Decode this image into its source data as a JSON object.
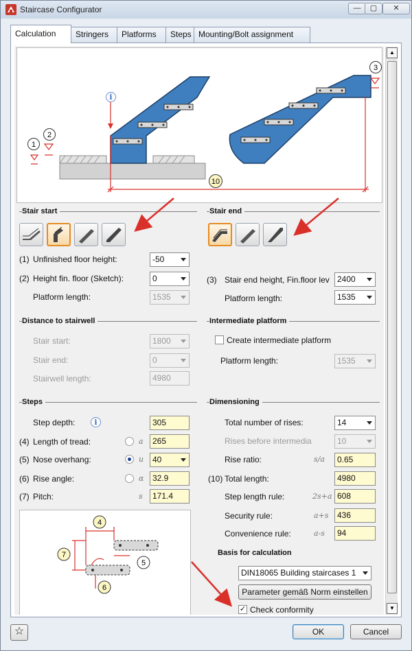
{
  "window": {
    "title": "Staircase Configurator",
    "minimize": "—",
    "maximize": "▢",
    "close": "✕"
  },
  "tabs": [
    "Calculation",
    "Stringers",
    "Platforms",
    "Steps",
    "Mounting/Bolt assignment"
  ],
  "diagram": {
    "markers": [
      "1",
      "2",
      "3",
      "10"
    ],
    "info": "i"
  },
  "stair_start": {
    "title": "Stair start",
    "unfinished_floor": {
      "num": "(1)",
      "label": "Unfinished floor height:",
      "value": "-50"
    },
    "height_fin_floor": {
      "num": "(2)",
      "label": "Height fin. floor  (Sketch):",
      "value": "0"
    },
    "platform_length": {
      "label": "Platform length:",
      "value": "1535"
    }
  },
  "stair_end": {
    "title": "Stair end",
    "end_height": {
      "num": "(3)",
      "label": "Stair end height, Fin.floor lev",
      "value": "2400"
    },
    "platform_length": {
      "label": "Platform length:",
      "value": "1535"
    }
  },
  "stairwell": {
    "title": "Distance to stairwell",
    "start": {
      "label": "Stair start:",
      "value": "1800"
    },
    "end": {
      "label": "Stair end:",
      "value": "0"
    },
    "length": {
      "label": "Stairwell length:",
      "value": "4980"
    }
  },
  "intermediate": {
    "title": "Intermediate platform",
    "create_label": "Create intermediate platform",
    "platform_length": {
      "label": "Platform length:",
      "value": "1535"
    }
  },
  "steps": {
    "title": "Steps",
    "step_depth": {
      "label": "Step depth:",
      "value": "305"
    },
    "tread": {
      "num": "(4)",
      "label": "Length of tread:",
      "sym": "a",
      "value": "265"
    },
    "nose": {
      "num": "(5)",
      "label": "Nose overhang:",
      "sym": "u",
      "value": "40"
    },
    "rise_angle": {
      "num": "(6)",
      "label": "Rise angle:",
      "sym": "α",
      "value": "32.9"
    },
    "pitch": {
      "num": "(7)",
      "label": "Pitch:",
      "sym": "s",
      "value": "171.4"
    },
    "sketch_markers": [
      "4",
      "5",
      "6",
      "7"
    ]
  },
  "dimensioning": {
    "title": "Dimensioning",
    "total_rises": {
      "label": "Total number of rises:",
      "value": "14"
    },
    "rises_before": {
      "label": "Rises before intermedia",
      "value": "10"
    },
    "rise_ratio": {
      "label": "Rise ratio:",
      "sym": "s/a",
      "value": "0.65"
    },
    "total_length": {
      "num": "(10)",
      "label": "Total length:",
      "value": "4980"
    },
    "step_length_rule": {
      "label": "Step length rule:",
      "sym": "2s+a",
      "value": "608"
    },
    "security_rule": {
      "label": "Security rule:",
      "sym": "a+s",
      "value": "436"
    },
    "convenience_rule": {
      "label": "Convenience rule:",
      "sym": "a-s",
      "value": "94"
    },
    "basis_title": "Basis for calculation",
    "basis_value": "DIN18065 Building staircases 1",
    "norm_button": "Parameter gemäß Norm einstellen",
    "check_label": "Check conformity",
    "check_mark": "✓"
  },
  "footer": {
    "ok": "OK",
    "cancel": "Cancel",
    "star": "☆"
  },
  "colors": {
    "stair_blue": "#3f7fbf",
    "dim_red": "#d9302a",
    "marker_fill": "#fcf6c4",
    "active_orange": "#e58a1f"
  }
}
